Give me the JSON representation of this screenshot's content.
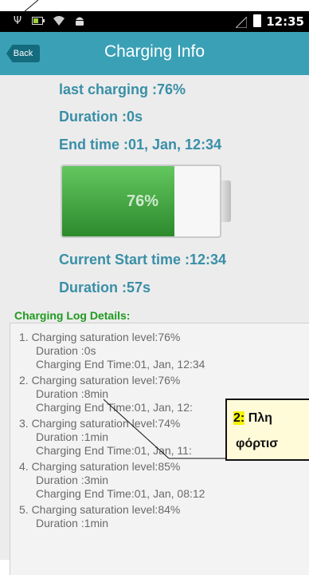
{
  "statusbar": {
    "time": "12:35",
    "icons": [
      "usb-icon",
      "battery-saver-icon",
      "wifi-icon",
      "android-icon",
      "signal-icon",
      "battery-icon"
    ]
  },
  "header": {
    "back_label": "Back",
    "title": "Charging Info"
  },
  "summary": {
    "last_charging": "last charging :76%",
    "duration": "Duration :0s",
    "end_time": "End time :01, Jan, 12:34",
    "current_start": "Current Start time :12:34",
    "current_duration": "Duration :57s"
  },
  "battery": {
    "percent_label": "76%",
    "level": 0.71,
    "fill_color": "#3da83d"
  },
  "log": {
    "title": "Charging Log Details:",
    "items": [
      {
        "title": "1. Charging saturation level:76%",
        "duration": "Duration :0s",
        "end": "Charging End Time:01, Jan, 12:34"
      },
      {
        "title": "2. Charging saturation level:76%",
        "duration": "Duration :8min",
        "end": "Charging End Time:01, Jan, 12:"
      },
      {
        "title": "3. Charging saturation level:74%",
        "duration": "Duration :1min",
        "end": "Charging End Time:01, Jan, 11:"
      },
      {
        "title": "4. Charging saturation level:85%",
        "duration": "Duration :3min",
        "end": "Charging End Time:01, Jan, 08:12"
      },
      {
        "title": "5. Charging saturation level:84%",
        "duration": "Duration :1min",
        "end": ""
      }
    ]
  },
  "overlay": {
    "number": "2:",
    "line1": "Πλη",
    "line2": "φόρτισ"
  },
  "colors": {
    "accent": "#3aa0b5",
    "info_text": "#3a8fa7",
    "log_title": "#1e9a1e"
  }
}
